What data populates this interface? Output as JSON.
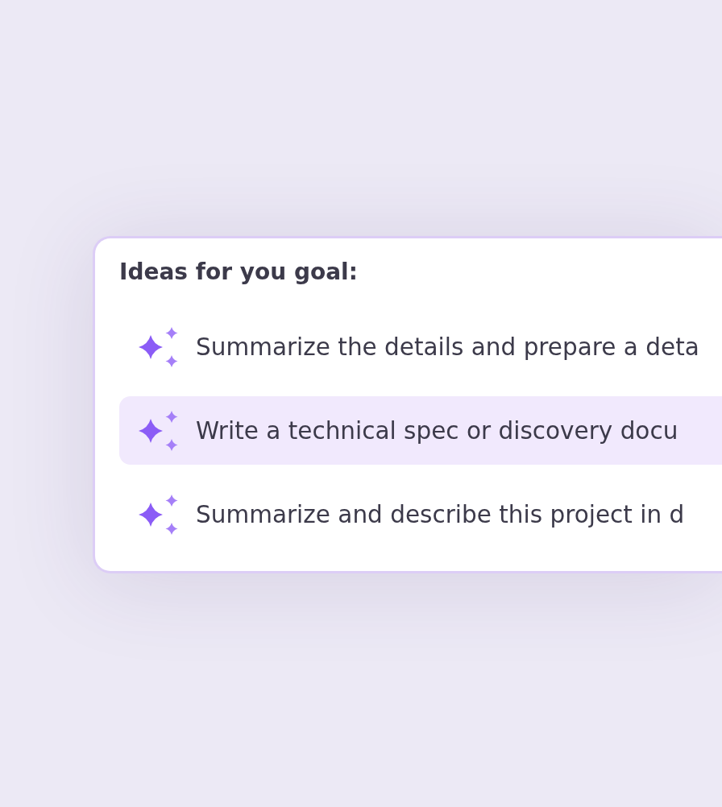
{
  "panel": {
    "title": "Ideas for you goal:",
    "ideas": [
      {
        "text": "Summarize the details and prepare a deta",
        "selected": false
      },
      {
        "text": "Write a technical spec or discovery docu",
        "selected": true
      },
      {
        "text": "Summarize and describe this project in d",
        "selected": false
      }
    ]
  }
}
